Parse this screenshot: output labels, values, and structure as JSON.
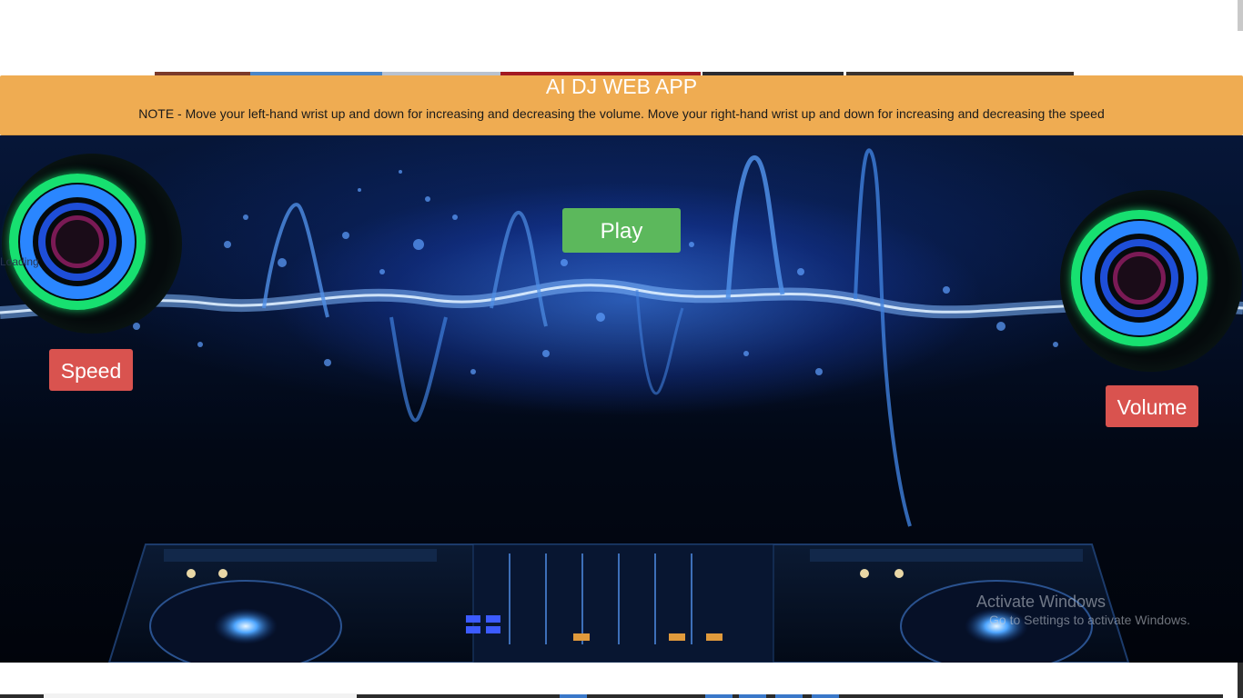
{
  "header": {
    "title": "AI DJ WEB APP",
    "note": "NOTE - Move your left-hand wrist up and down for increasing and decreasing the volume. Move your right-hand wrist up and down for increasing and decreasing the speed"
  },
  "controls": {
    "play_label": "Play",
    "speed_label": "Speed",
    "volume_label": "Volume"
  },
  "status": {
    "loading_text": "Loading"
  },
  "watermark": {
    "line1": "Activate Windows",
    "line2": "Go to Settings to activate Windows."
  },
  "colors": {
    "header_bg": "#efac52",
    "play_button": "#5cb85c",
    "action_button": "#d9534f"
  },
  "icons": [
    "speaker-disc-icon",
    "speaker-disc-icon",
    "dj-deck-image"
  ]
}
